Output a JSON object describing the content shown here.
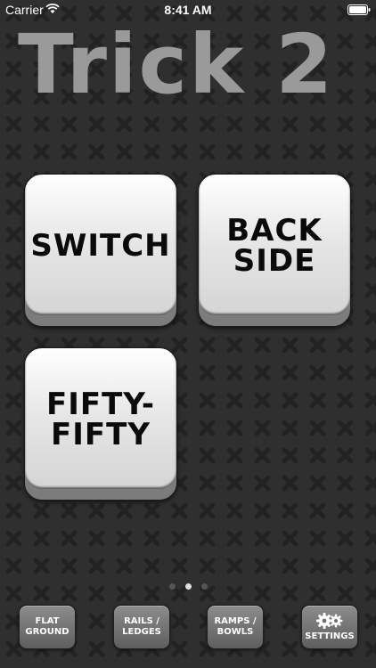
{
  "status_bar": {
    "carrier": "Carrier",
    "time": "8:41 AM"
  },
  "title": "Trick 2",
  "tiles": [
    {
      "label": "SWITCH"
    },
    {
      "label": "BACK\nSIDE"
    },
    {
      "label": "FIFTY-\nFIFTY"
    }
  ],
  "page_indicator": {
    "pages": 3,
    "current": 2
  },
  "nav": {
    "flat_ground": "FLAT\nGROUND",
    "rails_ledges": "RAILS /\nLEDGES",
    "ramps_bowls": "RAMPS /\nBOWLS",
    "settings": "SETTINGS"
  },
  "colors": {
    "background": "#2f2f2f",
    "pattern": "#252525",
    "title": "#9a9a9a"
  }
}
